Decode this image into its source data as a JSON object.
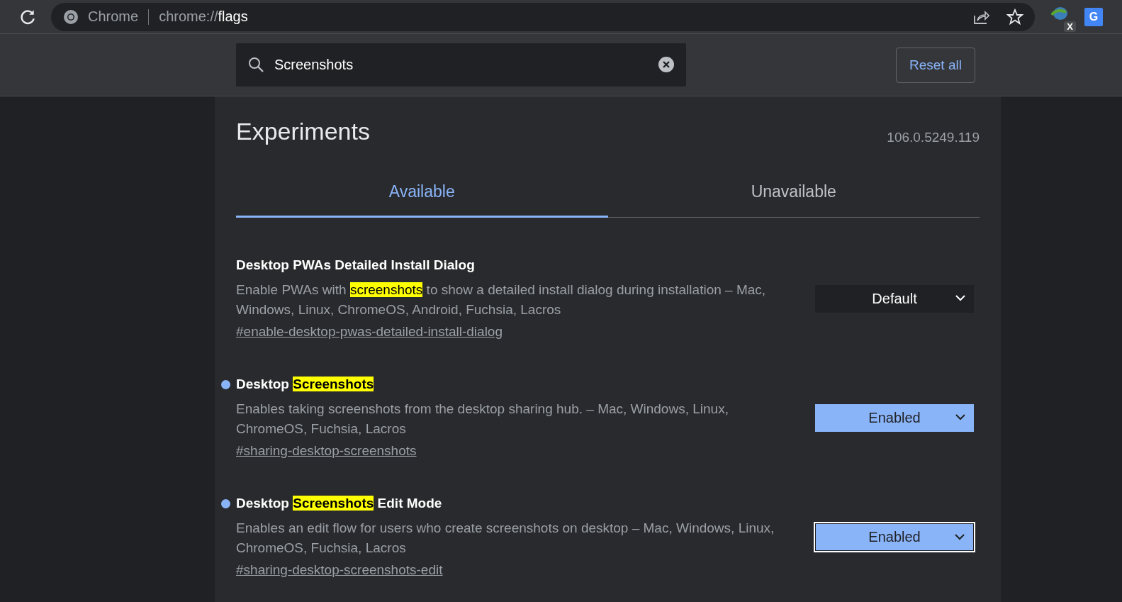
{
  "browser": {
    "site_label": "Chrome",
    "url_prefix": "chrome://",
    "url_path": "flags",
    "extension_badge": "X",
    "translate_letter": "G"
  },
  "search": {
    "value": "Screenshots"
  },
  "reset_button": "Reset all",
  "title": "Experiments",
  "version": "106.0.5249.119",
  "tabs": [
    {
      "label": "Available",
      "selected": true
    },
    {
      "label": "Unavailable",
      "selected": false
    }
  ],
  "flags": [
    {
      "modified": false,
      "title": [
        {
          "text": "Desktop PWAs Detailed Install Dialog",
          "highlight": false
        }
      ],
      "description": [
        {
          "text": "Enable PWAs with ",
          "highlight": false
        },
        {
          "text": "screenshots",
          "highlight": true
        },
        {
          "text": " to show a detailed install dialog during installation – Mac, Windows, Linux, ChromeOS, Android, Fuchsia, Lacros",
          "highlight": false
        }
      ],
      "link": "#enable-desktop-pwas-detailed-install-dialog",
      "value": "Default",
      "focused": false
    },
    {
      "modified": true,
      "title": [
        {
          "text": "Desktop ",
          "highlight": false
        },
        {
          "text": "Screenshots",
          "highlight": true
        }
      ],
      "description": [
        {
          "text": "Enables taking screenshots from the desktop sharing hub. – Mac, Windows, Linux, ChromeOS, Fuchsia, Lacros",
          "highlight": false
        }
      ],
      "link": "#sharing-desktop-screenshots",
      "value": "Enabled",
      "focused": false
    },
    {
      "modified": true,
      "title": [
        {
          "text": "Desktop ",
          "highlight": false
        },
        {
          "text": "Screenshots",
          "highlight": true
        },
        {
          "text": " Edit Mode",
          "highlight": false
        }
      ],
      "description": [
        {
          "text": "Enables an edit flow for users who create screenshots on desktop – Mac, Windows, Linux, ChromeOS, Fuchsia, Lacros",
          "highlight": false
        }
      ],
      "link": "#sharing-desktop-screenshots-edit",
      "value": "Enabled",
      "focused": true
    }
  ]
}
